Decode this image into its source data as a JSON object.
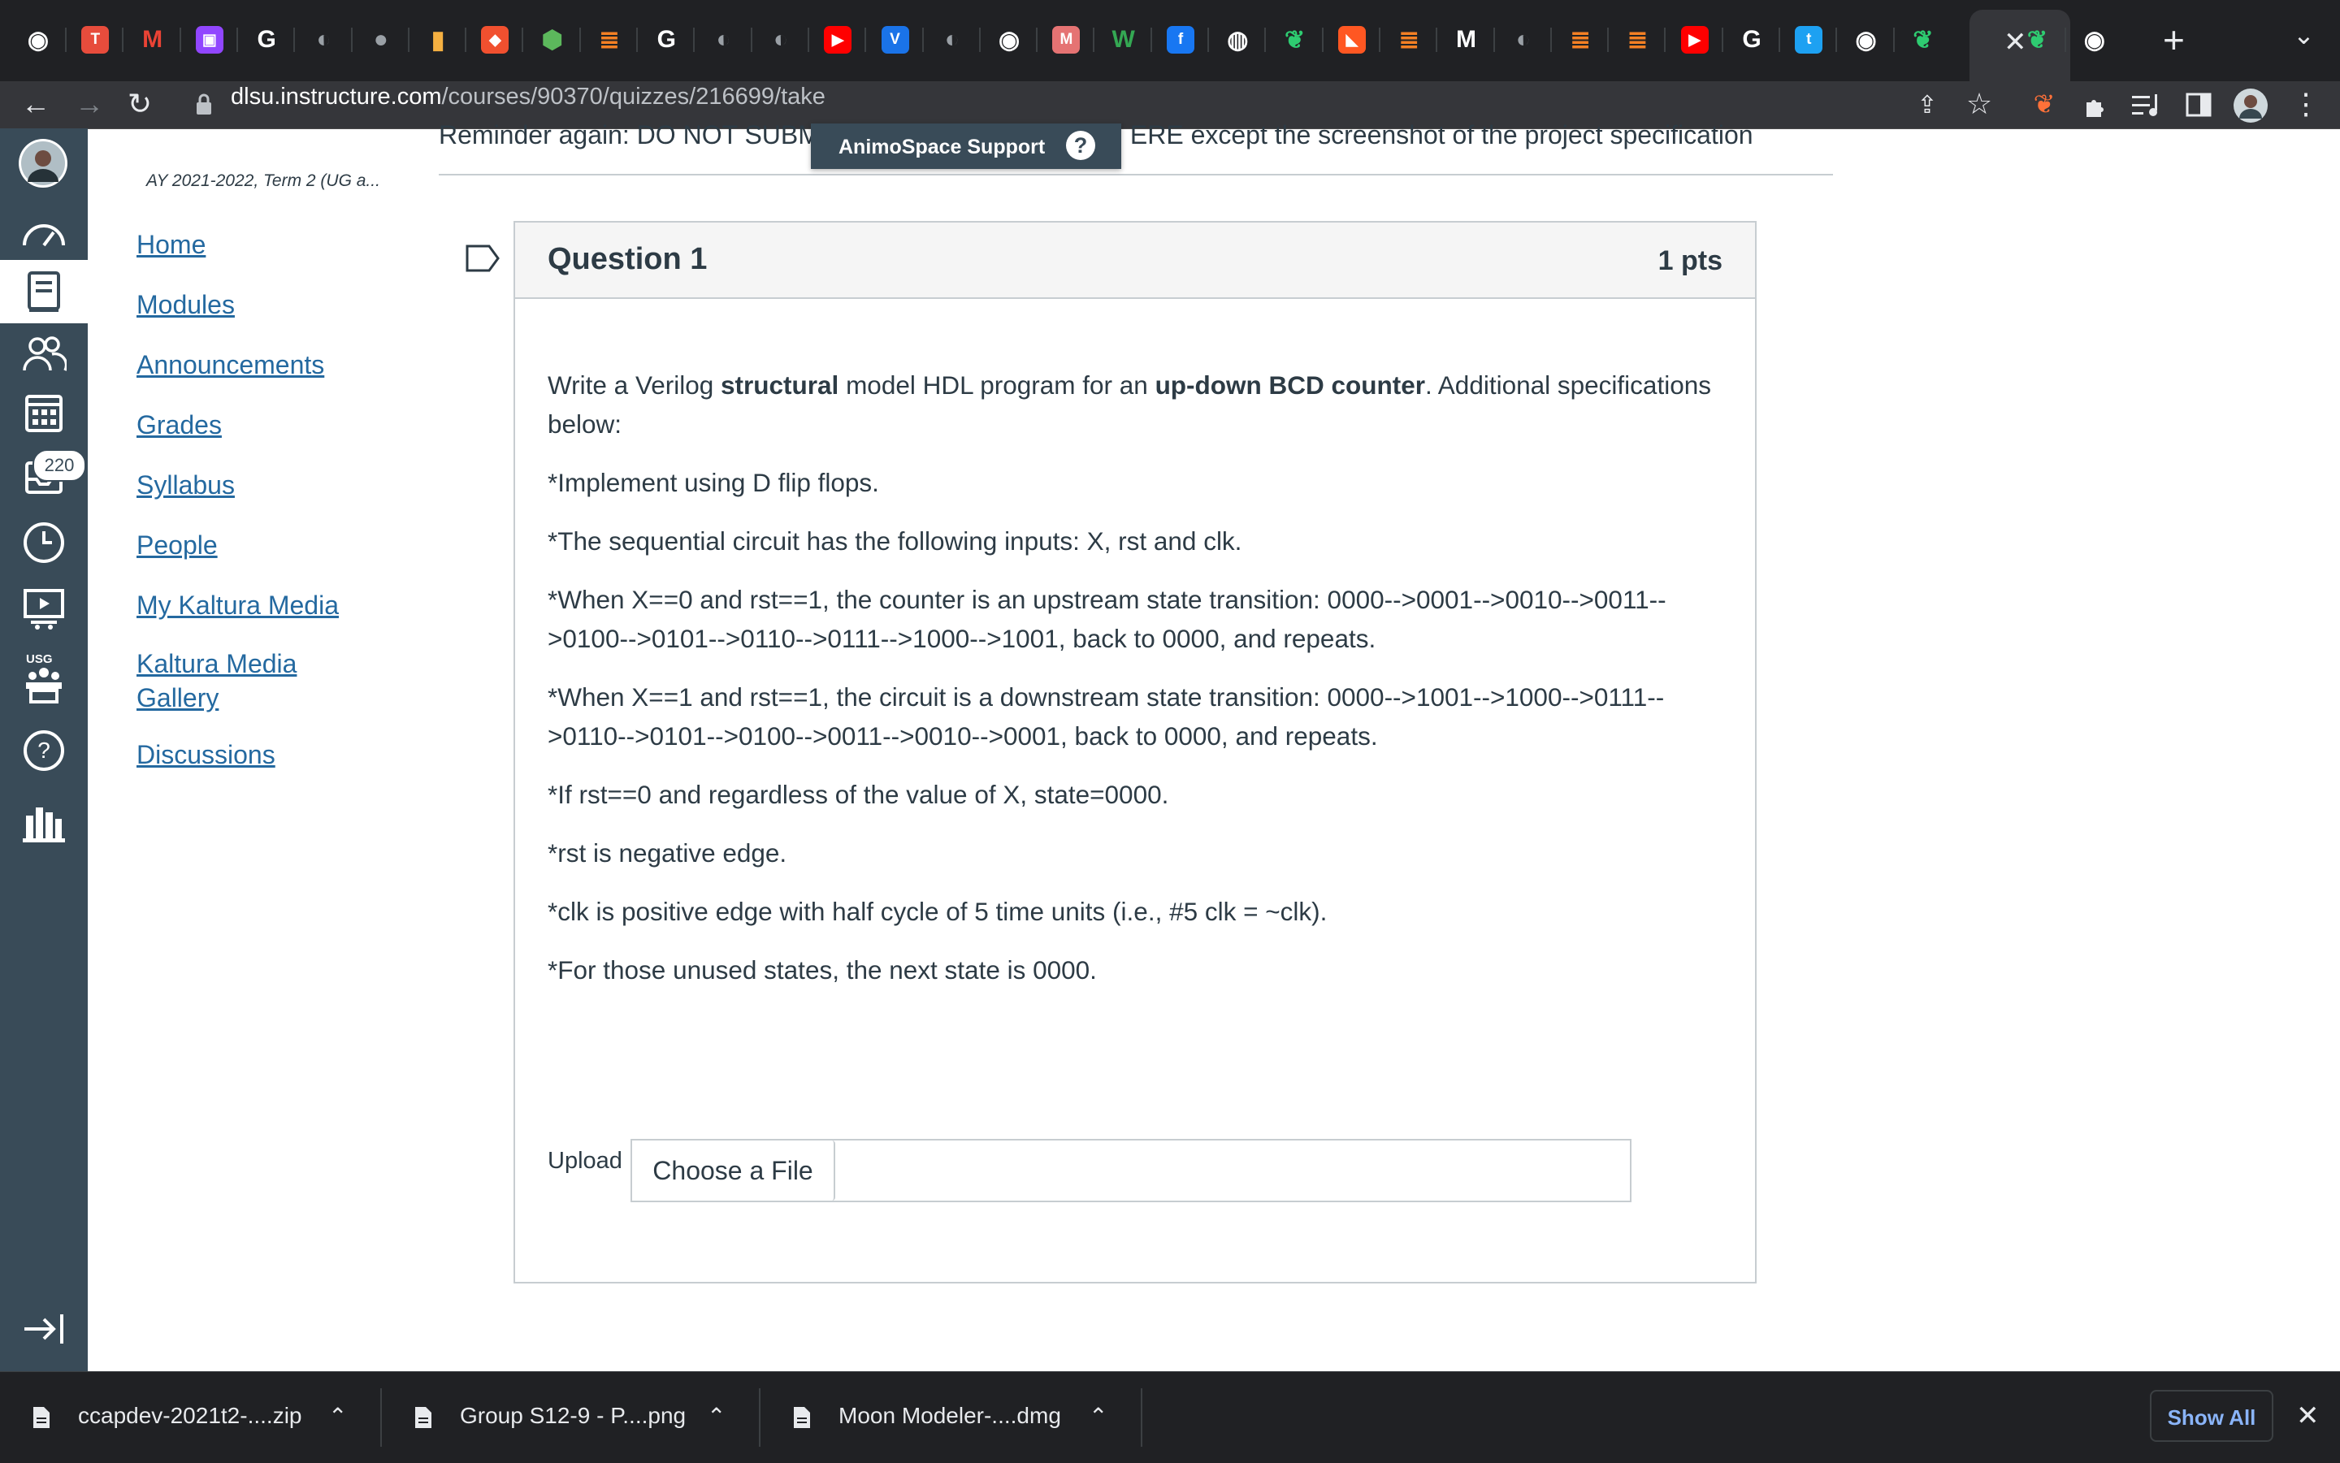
{
  "browser": {
    "tab_icons": [
      "chrome-icon",
      "textbook-icon",
      "gmail-icon",
      "twitch-icon",
      "google-icon",
      "globe-icon",
      "apple-icon",
      "bottle-icon",
      "git-icon",
      "shield-icon",
      "stackoverflow-icon",
      "google-icon",
      "globe-icon",
      "globe-icon",
      "youtube-icon",
      "v-icon",
      "globe-icon",
      "chrome-icon",
      "m-icon",
      "w-icon",
      "facebook-icon",
      "github-icon",
      "leaf-icon",
      "fox-icon",
      "stackoverflow-icon",
      "m-italic-icon",
      "globe-icon",
      "stackoverflow-icon",
      "stackoverflow-icon",
      "youtube-icon",
      "google-icon",
      "t-icon",
      "chrome-icon",
      "leaf-icon",
      "close-icon",
      "leaf-icon",
      "chrome-icon"
    ],
    "url_host": "dlsu.instructure.com",
    "url_path": "/courses/90370/quizzes/216699/take",
    "new_tab": "+",
    "tab_menu": "⌄"
  },
  "global_nav": {
    "items": [
      "account",
      "dashboard",
      "courses",
      "groups",
      "calendar",
      "inbox",
      "history",
      "studio",
      "commons",
      "help",
      "library"
    ],
    "inbox_badge": "220",
    "collapse_icon": "collapse-nav-icon"
  },
  "course_nav": {
    "term": "AY 2021-2022, Term 2 (UG a...",
    "links": [
      "Home",
      "Modules",
      "Announcements",
      "Grades",
      "Syllabus",
      "People",
      "My Kaltura Media",
      "Kaltura Media Gallery",
      "Discussions"
    ]
  },
  "main": {
    "reminder_left": "Reminder again: DO NOT SUBM",
    "reminder_right": "ERE except the screenshot of the project specification",
    "support_label": "AnimoSpace Support",
    "support_icon": "?",
    "question": {
      "title": "Question 1",
      "points": "1 pts",
      "intro_1": "Write a Verilog ",
      "intro_bold_1": "structural",
      "intro_2": " model HDL program for an ",
      "intro_bold_2": "up-down BCD counter",
      "intro_3": ".  Additional  specifications below:",
      "specs": [
        "*Implement using D flip flops.",
        "*The sequential circuit has the following inputs: X, rst and clk.",
        "*When X==0 and rst==1, the counter is an upstream state transition: 0000-->0001-->0010-->0011-->0100-->0101-->0110-->0111-->1000-->1001, back to 0000, and repeats.",
        "*When X==1 and rst==1, the circuit is a downstream state transition:  0000-->1001-->1000-->0111-->0110-->0101-->0100-->0011-->0010-->0001, back to 0000, and repeats.",
        "*If rst==0 and regardless of the value of X, state=0000.",
        "*rst is negative edge.",
        "*clk is positive edge with half cycle of 5 time units (i.e., #5 clk = ~clk).",
        "*For those unused states, the next state is 0000."
      ],
      "upload_label": "Upload",
      "choose_file": "Choose a File"
    }
  },
  "downloads": {
    "items": [
      "ccapdev-2021t2-....zip",
      "Group S12-9 - P....png",
      "Moon Modeler-....dmg"
    ],
    "show_all": "Show All"
  }
}
